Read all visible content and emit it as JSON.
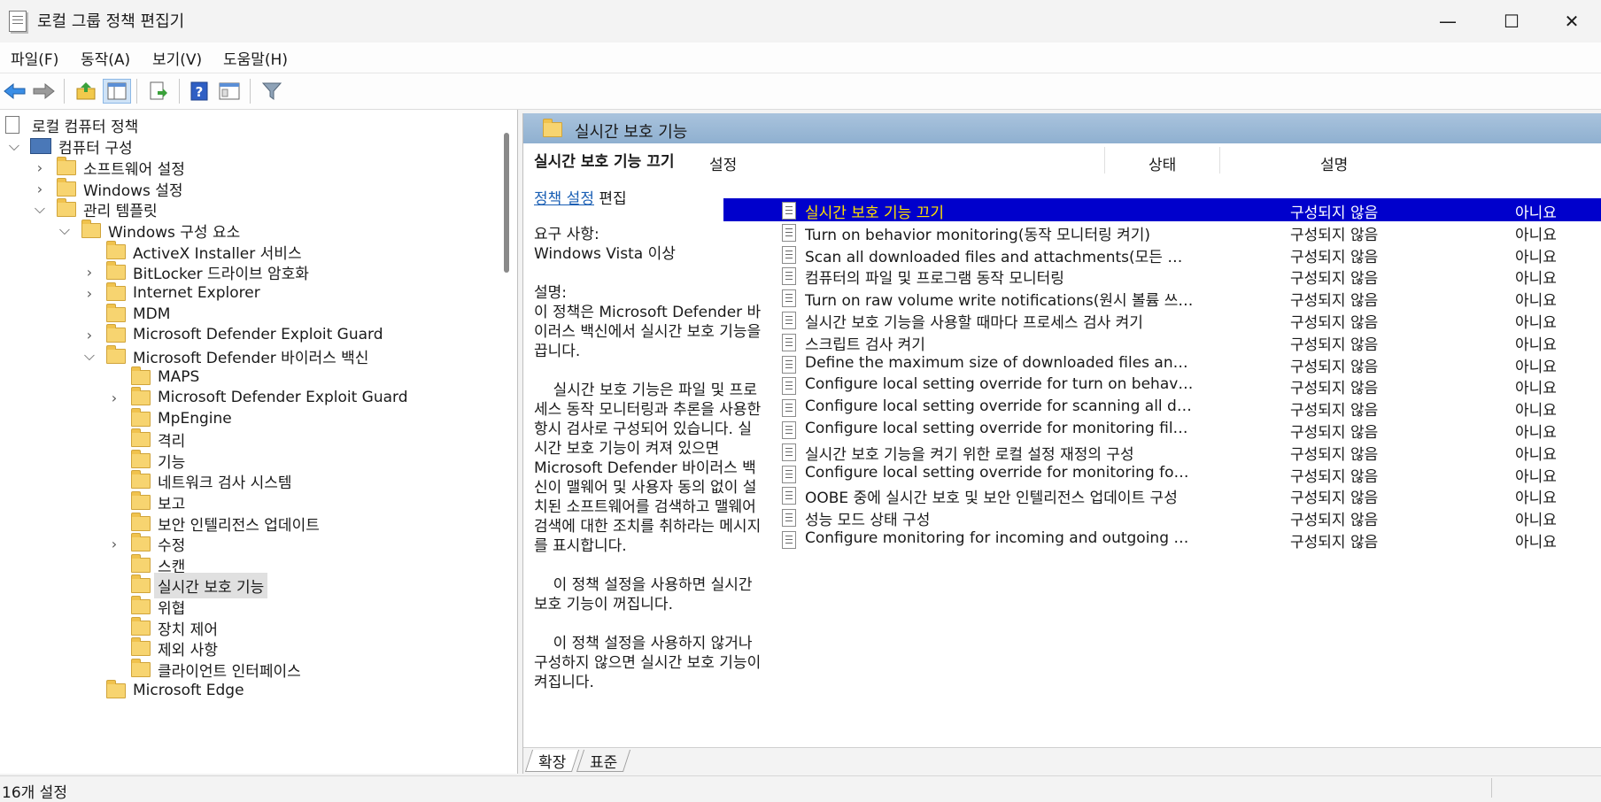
{
  "window": {
    "title": "로컬 그룹 정책 편집기",
    "minimize": "—",
    "maximize": "☐",
    "close": "✕"
  },
  "menu": {
    "file": "파일(F)",
    "action": "동작(A)",
    "view": "보기(V)",
    "help": "도움말(H)"
  },
  "toolbar": [
    "back-arrow-icon",
    "forward-arrow-icon",
    "up-folder-icon",
    "show-hide-tree-icon",
    "export-list-icon",
    "help-icon",
    "properties-icon",
    "filter-icon"
  ],
  "tree": {
    "root": "로컬 컴퓨터 정책",
    "computer_config": "컴퓨터 구성",
    "software_settings": "소프트웨어 설정",
    "windows_settings": "Windows 설정",
    "admin_templates": "관리 템플릿",
    "windows_components": "Windows 구성 요소",
    "activex": "ActiveX Installer 서비스",
    "bitlocker": "BitLocker 드라이브 암호화",
    "ie": "Internet Explorer",
    "mdm": "MDM",
    "exploit_guard": "Microsoft Defender Exploit Guard",
    "defender_av": "Microsoft Defender 바이러스 백신",
    "maps": "MAPS",
    "av_exploit_guard": "Microsoft Defender Exploit Guard",
    "mpengine": "MpEngine",
    "quarantine": "격리",
    "features": "기능",
    "network_inspection": "네트워크 검사 시스템",
    "reporting": "보고",
    "security_intel": "보안 인텔리전스 업데이트",
    "remediation": "수정",
    "scan": "스캔",
    "realtime": "실시간 보호 기능",
    "threats": "위협",
    "device_control": "장치 제어",
    "exclusions": "제외 사항",
    "client_interface": "클라이언트 인터페이스",
    "edge": "Microsoft Edge"
  },
  "banner": {
    "title": "실시간 보호 기능"
  },
  "description": {
    "heading": "실시간 보호 기능 끄기",
    "edit_link": "정책 설정",
    "edit_suffix": " 편집",
    "body": "요구 사항:\nWindows Vista 이상\n\n설명:\n이 정책은 Microsoft Defender 바이러스 백신에서 실시간 보호 기능을 끕니다.\n\n    실시간 보호 기능은 파일 및 프로세스 동작 모니터링과 추론을 사용한 항시 검사로 구성되어 있습니다. 실시간 보호 기능이 켜져 있으면 Microsoft Defender 바이러스 백신이 맬웨어 및 사용자 동의 없이 설치된 소프트웨어를 검색하고 맬웨어 검색에 대한 조치를 취하라는 메시지를 표시합니다.\n\n    이 정책 설정을 사용하면 실시간 보호 기능이 꺼집니다.\n\n    이 정책 설정을 사용하지 않거나 구성하지 않으면 실시간 보호 기능이 켜집니다."
  },
  "list": {
    "headers": {
      "setting": "설정",
      "state": "상태",
      "comment": "설명"
    },
    "rows": [
      {
        "name": "실시간 보호 기능 끄기",
        "state": "구성되지 않음",
        "comment": "아니요"
      },
      {
        "name": "Turn on behavior monitoring(동작 모니터링 켜기)",
        "state": "구성되지 않음",
        "comment": "아니요"
      },
      {
        "name": "Scan all downloaded files and attachments(모든 다운로드한…",
        "state": "구성되지 않음",
        "comment": "아니요"
      },
      {
        "name": "컴퓨터의 파일 및 프로그램 동작 모니터링",
        "state": "구성되지 않음",
        "comment": "아니요"
      },
      {
        "name": "Turn on raw volume write notifications(원시 볼륨 쓰기 알림…",
        "state": "구성되지 않음",
        "comment": "아니요"
      },
      {
        "name": "실시간 보호 기능을 사용할 때마다 프로세스 검사 켜기",
        "state": "구성되지 않음",
        "comment": "아니요"
      },
      {
        "name": "스크립트 검사 켜기",
        "state": "구성되지 않음",
        "comment": "아니요"
      },
      {
        "name": "Define the maximum size of downloaded files and attachm…",
        "state": "구성되지 않음",
        "comment": "아니요"
      },
      {
        "name": "Configure local setting override for turn on behavior monit…",
        "state": "구성되지 않음",
        "comment": "아니요"
      },
      {
        "name": "Configure local setting override for scanning all downloade…",
        "state": "구성되지 않음",
        "comment": "아니요"
      },
      {
        "name": "Configure local setting override for monitoring file and pro…",
        "state": "구성되지 않음",
        "comment": "아니요"
      },
      {
        "name": "실시간 보호 기능을 켜기 위한 로컬 설정 재정의 구성",
        "state": "구성되지 않음",
        "comment": "아니요"
      },
      {
        "name": "Configure local setting override for monitoring for incomin…",
        "state": "구성되지 않음",
        "comment": "아니요"
      },
      {
        "name": "OOBE 중에 실시간 보호 및 보안 인텔리전스 업데이트 구성",
        "state": "구성되지 않음",
        "comment": "아니요"
      },
      {
        "name": "성능 모드 상태 구성",
        "state": "구성되지 않음",
        "comment": "아니요"
      },
      {
        "name": "Configure monitoring for incoming and outgoing file and …",
        "state": "구성되지 않음",
        "comment": "아니요"
      }
    ]
  },
  "tabs": {
    "extended": "확장",
    "standard": "표준"
  },
  "status": {
    "count": "16개 설정"
  }
}
